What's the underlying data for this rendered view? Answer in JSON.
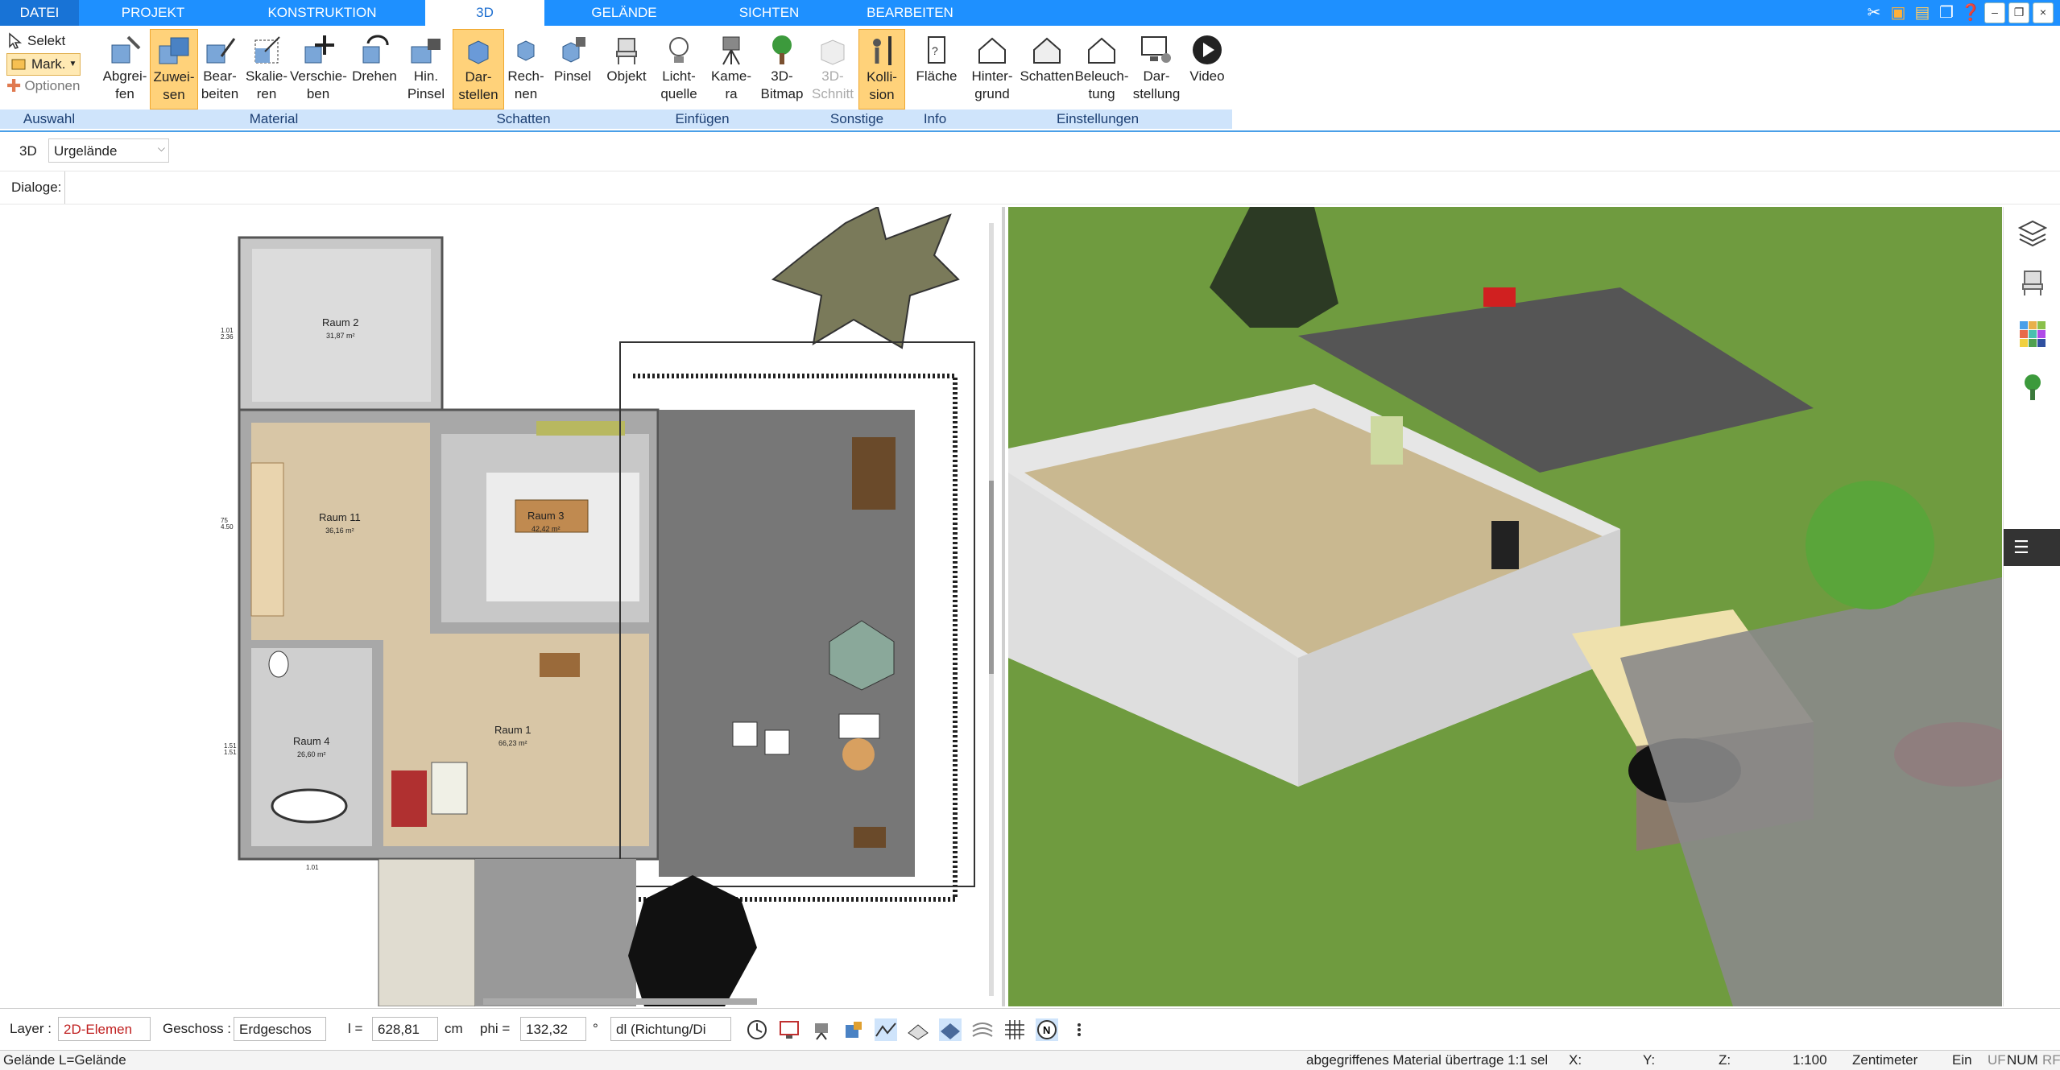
{
  "tabs": [
    "DATEI",
    "PROJEKT",
    "KONSTRUKTION",
    "3D",
    "GELÄNDE",
    "SICHTEN",
    "BEARBEITEN"
  ],
  "active_tab": "3D",
  "selection": {
    "select_label": "Selekt",
    "mark_label": "Mark.",
    "options_label": "Optionen",
    "group": "Auswahl"
  },
  "ribbon": {
    "material": {
      "group": "Material",
      "buttons": [
        "Abgrei-\nfen",
        "Zuwei-\nsen",
        "Bear-\nbeiten",
        "Skalie-\nren",
        "Verschie-\nben",
        "Drehen",
        "Hin.\nPinsel"
      ]
    },
    "schatten": {
      "group": "Schatten",
      "buttons": [
        "Dar-\nstellen",
        "Rech-\nnen",
        "Pinsel"
      ]
    },
    "einfuegen": {
      "group": "Einfügen",
      "buttons": [
        "Objekt",
        "Licht-\nquelle",
        "Kame-\nra",
        "3D-\nBitmap"
      ]
    },
    "sonstige": {
      "group": "Sonstige",
      "buttons": [
        "3D-\nSchnitt",
        "Kolli-\nsion"
      ]
    },
    "info": {
      "group": "Info",
      "buttons": [
        "Fläche"
      ]
    },
    "einstellungen": {
      "group": "Einstellungen",
      "buttons": [
        "Hinter-\ngrund",
        "Schatten",
        "Beleuch-\ntung",
        "Dar-\nstellung",
        "Video"
      ]
    }
  },
  "mode_label": "3D",
  "terrain_select": "Urgelände",
  "dialogs_label": "Dialoge:",
  "plan": {
    "rooms": [
      {
        "name": "Raum 2",
        "area": "31,87 m²"
      },
      {
        "name": "Raum 11",
        "area": "36,16 m²"
      },
      {
        "name": "Raum 3",
        "area": "42,42 m²"
      },
      {
        "name": "Raum 1",
        "area": "66,23 m²"
      },
      {
        "name": "Raum 4",
        "area": "26,60 m²"
      }
    ],
    "dims": [
      "1.01",
      "2.36",
      "75",
      "4.50",
      "1.51",
      "1.51",
      "1.01"
    ]
  },
  "bottombar": {
    "layer_label": "Layer :",
    "layer_value": "2D-Elemen",
    "geschoss_label": "Geschoss :",
    "geschoss_value": "Erdgeschos",
    "l_label": "l =",
    "l_value": "628,81",
    "l_unit": "cm",
    "phi_label": "phi =",
    "phi_value": "132,32",
    "phi_unit": "°",
    "dl_value": "dl (Richtung/Di"
  },
  "status": {
    "left": "Gelände L=Gelände",
    "message": "abgegriffenes Material übertrage 1:1 sel",
    "x": "X:",
    "y": "Y:",
    "z": "Z:",
    "scale": "1:100",
    "unit": "Zentimeter",
    "ein": "Ein",
    "uf": "UF",
    "num": "NUM",
    "rf": "RF"
  },
  "colors": {
    "accent": "#1e90ff",
    "highlight": "#ffd27a",
    "group_bg": "#cfe4fb",
    "grass": "#6a9a3b"
  }
}
